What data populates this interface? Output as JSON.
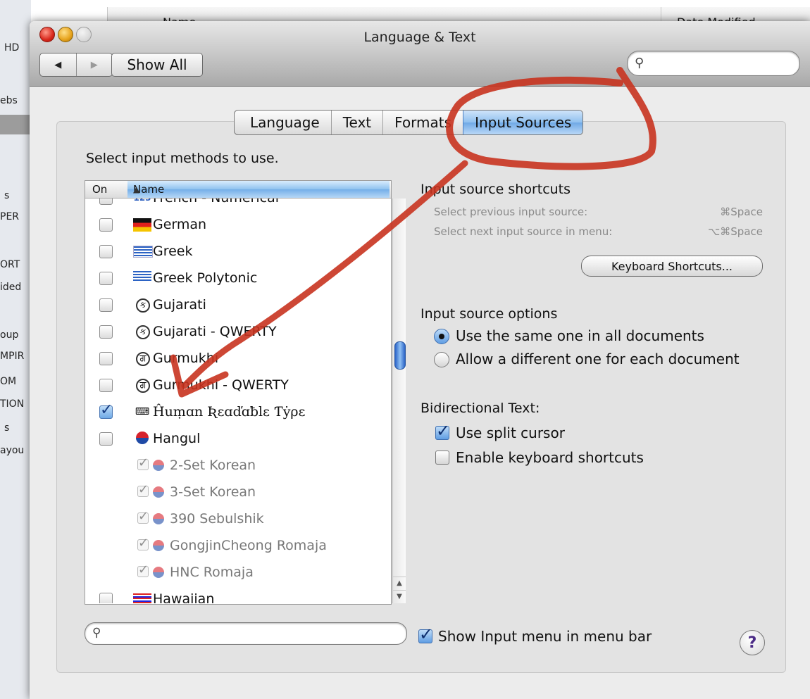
{
  "background_window": {
    "column_name": "Name",
    "column_date": "Date Modified",
    "sidebar_fragments": [
      "HD",
      "ebs",
      "s",
      "PER",
      "ORT",
      "ided",
      "oup",
      "MPIR",
      "OM",
      "TION",
      "s",
      "ayou"
    ]
  },
  "window": {
    "title": "Language & Text",
    "nav_back": "◀",
    "nav_forward": "▶",
    "show_all_label": "Show All",
    "search_icon": "magnifier-icon"
  },
  "tabs": [
    {
      "label": "Language",
      "active": false
    },
    {
      "label": "Text",
      "active": false
    },
    {
      "label": "Formats",
      "active": false
    },
    {
      "label": "Input Sources",
      "active": true
    }
  ],
  "prompt": "Select input methods to use.",
  "list": {
    "col_on": "On",
    "col_name": "Name",
    "sort_indicator": "▲",
    "rows": [
      {
        "label": "French - Numerical",
        "checked": false,
        "icon": "numeric-123-icon",
        "sub": false
      },
      {
        "label": "German",
        "checked": false,
        "icon": "german-flag-icon",
        "sub": false
      },
      {
        "label": "Greek",
        "checked": false,
        "icon": "greek-flag-icon",
        "sub": false
      },
      {
        "label": "Greek Polytonic",
        "checked": false,
        "icon": "greek-polytonic-flag-icon",
        "sub": false
      },
      {
        "label": "Gujarati",
        "checked": false,
        "icon": "gujarati-script-icon",
        "sub": false
      },
      {
        "label": "Gujarati - QWERTY",
        "checked": false,
        "icon": "gujarati-qwerty-icon",
        "sub": false
      },
      {
        "label": "Gurmukhi",
        "checked": false,
        "icon": "gurmukhi-script-icon",
        "sub": false
      },
      {
        "label": "Gurmukhi - QWERTY",
        "checked": false,
        "icon": "gurmukhi-qwerty-icon",
        "sub": false
      },
      {
        "label": "Ĥuṃɑn Ʀɛɑďɑƀlɛ Ƭẏρɛ",
        "checked": true,
        "icon": "keyboard-icon",
        "sub": false
      },
      {
        "label": "Hangul",
        "checked": false,
        "icon": "korea-flag-icon",
        "sub": false
      },
      {
        "label": "2-Set Korean",
        "checked": true,
        "icon": "korea-flag-icon",
        "sub": true
      },
      {
        "label": "3-Set Korean",
        "checked": true,
        "icon": "korea-flag-icon",
        "sub": true
      },
      {
        "label": "390 Sebulshik",
        "checked": true,
        "icon": "korea-flag-icon",
        "sub": true
      },
      {
        "label": "GongjinCheong Romaja",
        "checked": true,
        "icon": "korea-flag-icon",
        "sub": true
      },
      {
        "label": "HNC Romaja",
        "checked": true,
        "icon": "korea-flag-icon",
        "sub": true
      },
      {
        "label": "Hawaiian",
        "checked": false,
        "icon": "hawaii-flag-icon",
        "sub": false
      }
    ],
    "scroll_fraction": 0.35
  },
  "shortcuts": {
    "heading": "Input source shortcuts",
    "prev_label": "Select previous input source:",
    "prev_key": "⌘Space",
    "next_label": "Select next input source in menu:",
    "next_key": "⌥⌘Space",
    "button_label": "Keyboard Shortcuts..."
  },
  "options": {
    "heading": "Input source options",
    "radio_same": "Use the same one in all documents",
    "radio_same_selected": true,
    "radio_different": "Allow a different one for each document",
    "radio_different_selected": false
  },
  "bidi": {
    "heading": "Bidirectional Text:",
    "split_cursor_label": "Use split cursor",
    "split_cursor_checked": true,
    "kbd_shortcuts_label": "Enable keyboard shortcuts",
    "kbd_shortcuts_checked": false
  },
  "bottom": {
    "search_placeholder": "",
    "show_menu_label": "Show Input menu in menu bar",
    "show_menu_checked": true,
    "help_label": "?"
  },
  "colors": {
    "annotation_red": "#c8331f",
    "selection_blue": "#6fa9e6"
  }
}
